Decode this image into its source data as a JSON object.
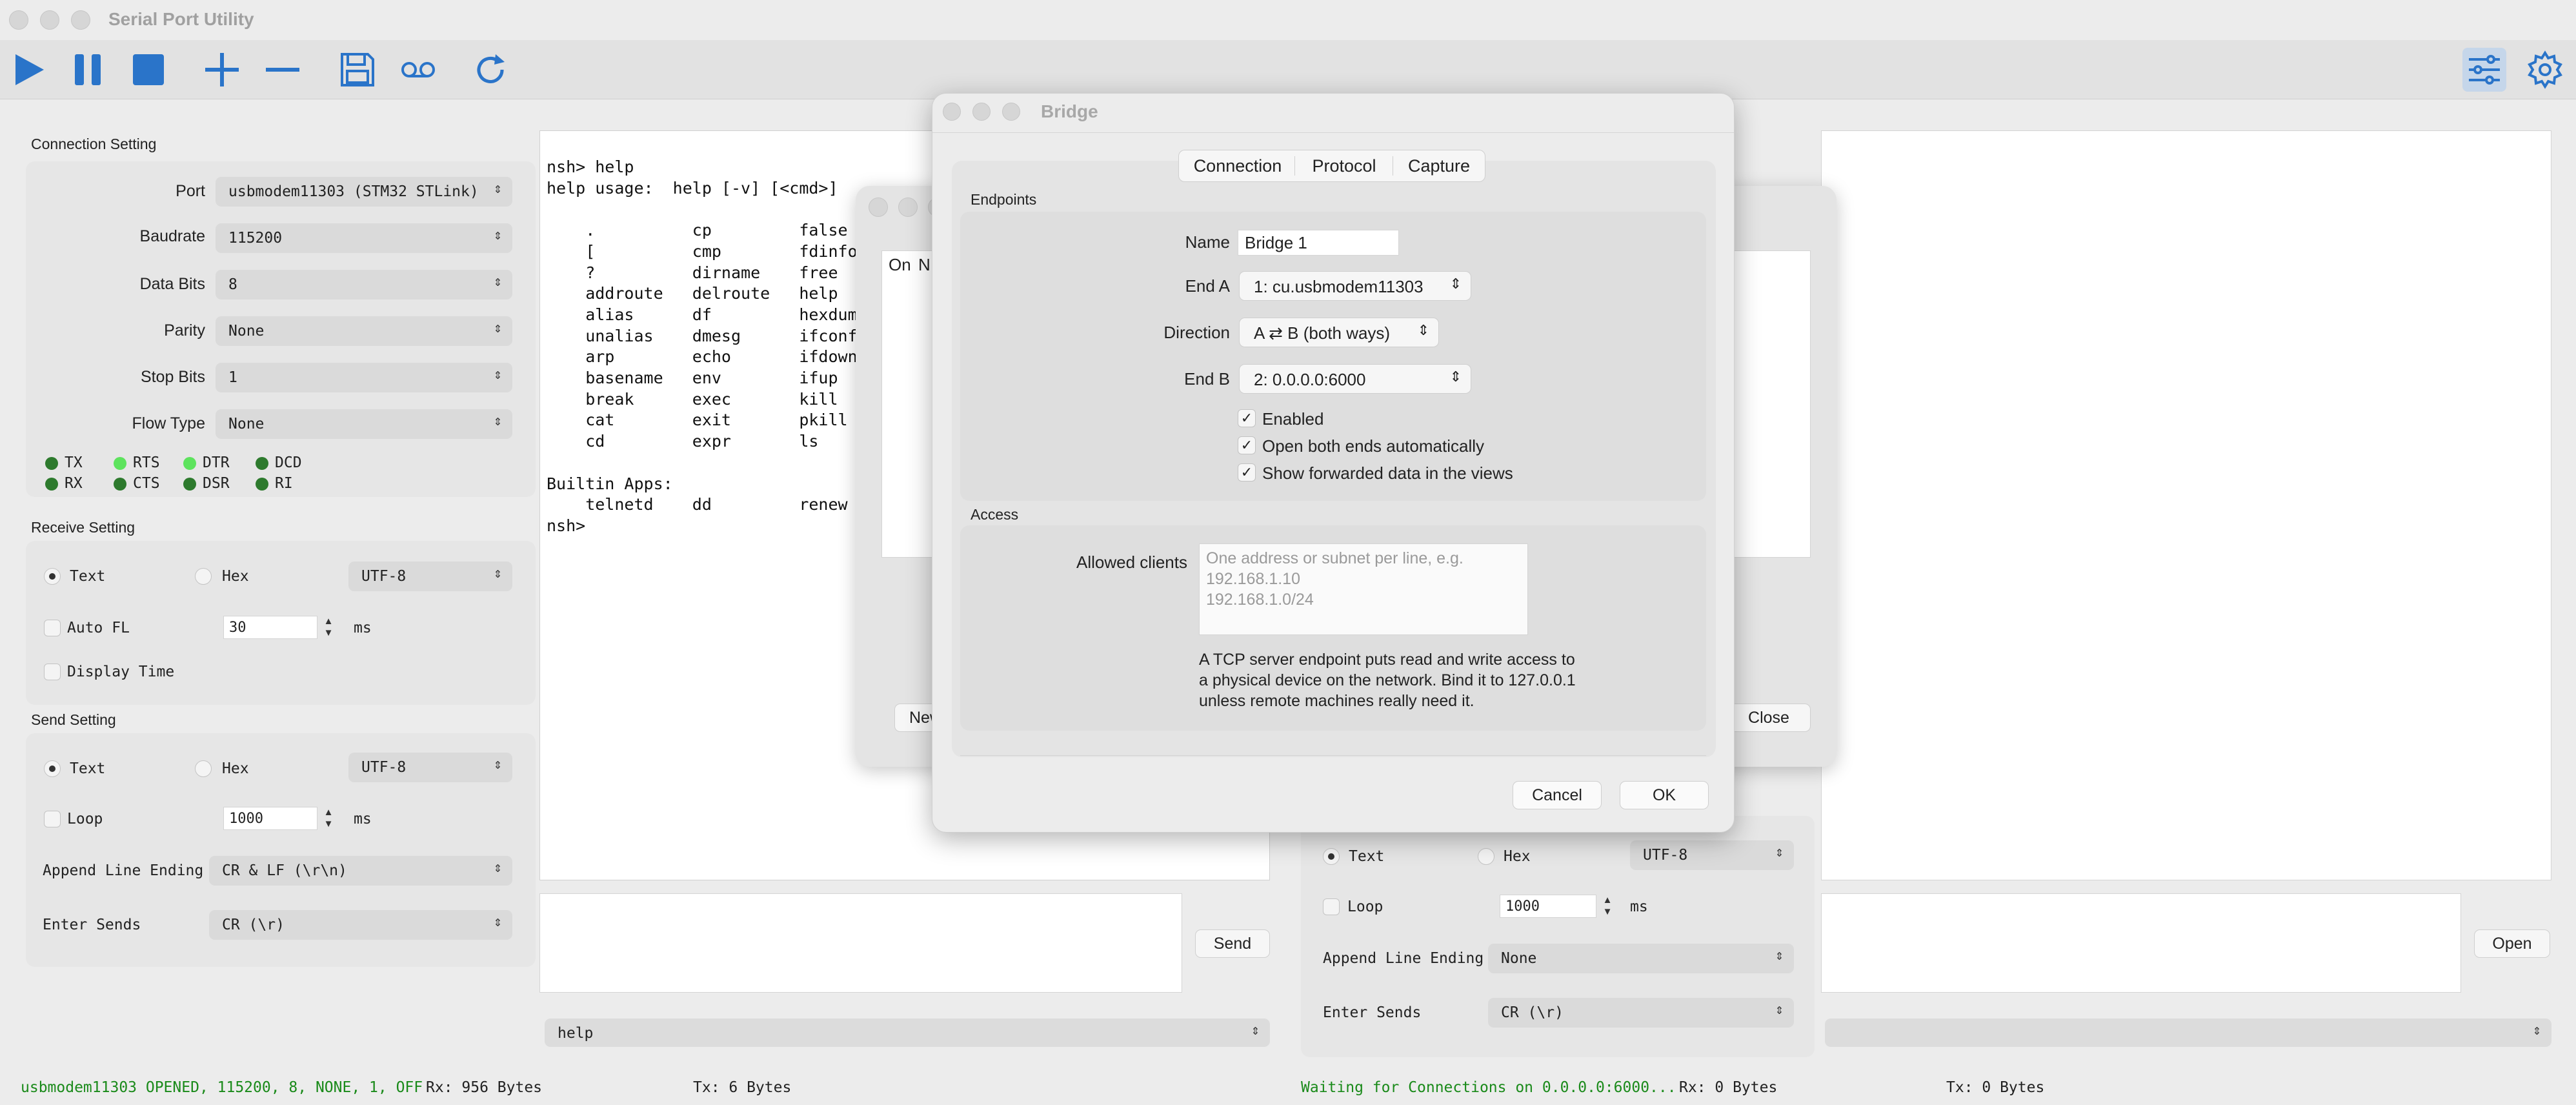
{
  "app": {
    "title": "Serial Port Utility"
  },
  "connection": {
    "title": "Connection Setting",
    "port_label": "Port",
    "port_value": "usbmodem11303 (STM32 STLink)",
    "baud_label": "Baudrate",
    "baud_value": "115200",
    "databits_label": "Data Bits",
    "databits_value": "8",
    "parity_label": "Parity",
    "parity_value": "None",
    "stopbits_label": "Stop Bits",
    "stopbits_value": "1",
    "flow_label": "Flow Type",
    "flow_value": "None",
    "signals": [
      "TX",
      "RTS",
      "DTR",
      "DCD",
      "RX",
      "CTS",
      "DSR",
      "RI"
    ]
  },
  "receive": {
    "title": "Receive Setting",
    "text_label": "Text",
    "hex_label": "Hex",
    "encoding": "UTF-8",
    "autofl_label": "Auto FL",
    "autofl_value": "30",
    "ms": "ms",
    "displaytime_label": "Display Time"
  },
  "send": {
    "title": "Send Setting",
    "text_label": "Text",
    "hex_label": "Hex",
    "encoding": "UTF-8",
    "loop_label": "Loop",
    "loop_value": "1000",
    "ms": "ms",
    "append_label": "Append Line Ending",
    "append_value": "CR & LF (\\r\\n)",
    "enter_label": "Enter Sends",
    "enter_value": "CR (\\r)",
    "send_button": "Send",
    "history": "help"
  },
  "terminal": {
    "lines": [
      "nsh> help",
      "help usage:  help [-v] [<cmd>]",
      "",
      "    .          cp         false",
      "    [          cmp        fdinfo",
      "    ?          dirname    free",
      "    addroute   delroute   help",
      "    alias      df         hexdump",
      "    unalias    dmesg      ifconfig",
      "    arp        echo       ifdown",
      "    basename   env        ifup",
      "    break      exec       kill",
      "    cat        exit       pkill",
      "    cd         expr       ls",
      "",
      "Builtin Apps:",
      "    telnetd    dd         renew",
      "nsh>"
    ]
  },
  "right": {
    "text_label": "Text",
    "hex_label": "Hex",
    "encoding": "UTF-8",
    "loop_label": "Loop",
    "loop_value": "1000",
    "ms": "ms",
    "append_label": "Append Line Ending",
    "append_value": "None",
    "enter_label": "Enter Sends",
    "enter_value": "CR (\\r)",
    "open_button": "Open"
  },
  "window2": {
    "col_on": "On",
    "col_n": "N",
    "new_button": "New",
    "close_button": "Close"
  },
  "bridge": {
    "title": "Bridge",
    "tabs": [
      "Connection",
      "Protocol",
      "Capture"
    ],
    "endpoints_title": "Endpoints",
    "name_label": "Name",
    "name_value": "Bridge 1",
    "enda_label": "End A",
    "enda_value": "1: cu.usbmodem11303",
    "direction_label": "Direction",
    "direction_value": "A ⇄ B (both ways)",
    "endb_label": "End B",
    "endb_value": "2: 0.0.0.0:6000",
    "enabled_label": "Enabled",
    "openboth_label": "Open both ends automatically",
    "show_label": "Show forwarded data in the views",
    "access_title": "Access",
    "allowed_label": "Allowed clients",
    "allowed_placeholder": [
      "One address or subnet per line, e.g.",
      "192.168.1.10",
      "192.168.1.0/24"
    ],
    "info": [
      "A TCP server endpoint puts read and write access to",
      "a physical device on the network. Bind it to 127.0.0.1",
      "unless remote machines really need it."
    ],
    "cancel_button": "Cancel",
    "ok_button": "OK"
  },
  "status": {
    "left": "usbmodem11303 OPENED, 115200, 8, NONE, 1, OFF",
    "rx_left": "Rx: 956 Bytes",
    "tx_left": "Tx: 6 Bytes",
    "right": "Waiting for Connections on 0.0.0.0:6000...",
    "rx_right": "Rx: 0 Bytes",
    "tx_right": "Tx: 0 Bytes"
  },
  "colors": {
    "accent": "#2a74c9",
    "led_on": "#5de35d",
    "led_off": "#2d7a2d",
    "status_green": "#1a8a1a"
  }
}
